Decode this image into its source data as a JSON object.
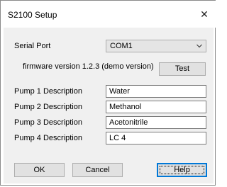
{
  "window": {
    "title": "S2100 Setup",
    "close_glyph": "✕"
  },
  "serial_port": {
    "label": "Serial Port",
    "value": "COM1"
  },
  "firmware": {
    "text": "firmware version 1.2.3 (demo version)"
  },
  "buttons": {
    "test": "Test",
    "ok": "OK",
    "cancel": "Cancel",
    "help": "Help"
  },
  "pumps": [
    {
      "label": "Pump 1 Description",
      "value": "Water"
    },
    {
      "label": "Pump 2 Description",
      "value": "Methanol"
    },
    {
      "label": "Pump 3 Description",
      "value": "Acetonitrile"
    },
    {
      "label": "Pump 4 Description",
      "value": "LC 4"
    }
  ],
  "colors": {
    "accent": "#0078d7",
    "client_bg": "#f0f0f0",
    "button_bg": "#e1e1e1"
  }
}
